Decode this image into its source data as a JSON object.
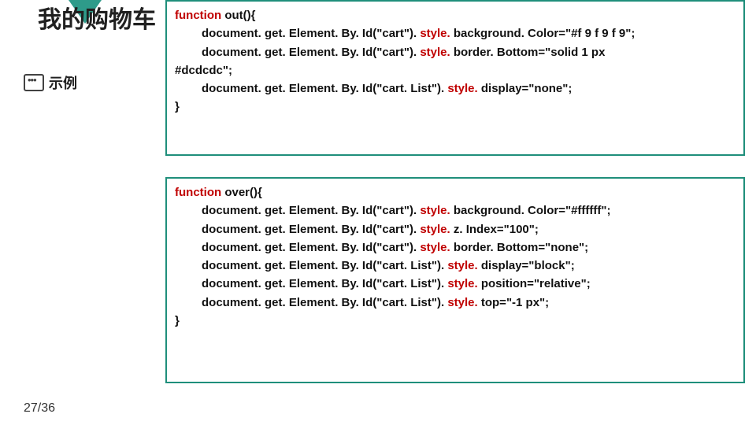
{
  "header": {
    "title": "我的购物车"
  },
  "sidebar": {
    "label": "示例"
  },
  "page_number": "27/36",
  "code1": {
    "l1a": "function ",
    "l1b": "out(){",
    "l2a": "document. get. Element. By. Id(\"cart\"). ",
    "l2b": "style. ",
    "l2c": "background. Color=\"#f 9 f 9 f 9\"; ",
    "l3a": "document. get. Element. By. Id(\"cart\"). ",
    "l3b": "style. ",
    "l3c": "border. Bottom=\"solid 1 px ",
    "l4": "#dcdcdc\"; ",
    "l5a": "document. get. Element. By. Id(\"cart. List\"). ",
    "l5b": "style. ",
    "l5c": "display=\"none\"; ",
    "l6": "  }"
  },
  "code2": {
    "l1a": "function ",
    "l1b": "over(){",
    "l2a": "document. get. Element. By. Id(\"cart\"). ",
    "l2b": "style. ",
    "l2c": "background. Color=\"#ffffff\"; ",
    "l3a": "document. get. Element. By. Id(\"cart\"). ",
    "l3b": "style. ",
    "l3c": "z. Index=\"100\"; ",
    "l4a": "document. get. Element. By. Id(\"cart\"). ",
    "l4b": "style. ",
    "l4c": "border. Bottom=\"none\"; ",
    "l5a": "document. get. Element. By. Id(\"cart. List\"). ",
    "l5b": "style. ",
    "l5c": "display=\"block\"; ",
    "l6a": "document. get. Element. By. Id(\"cart. List\"). ",
    "l6b": "style. ",
    "l6c": "position=\"relative\"; ",
    "l7a": "document. get. Element. By. Id(\"cart. List\"). ",
    "l7b": "style. ",
    "l7c": "top=\"-1 px\"; ",
    "l8": "}"
  }
}
